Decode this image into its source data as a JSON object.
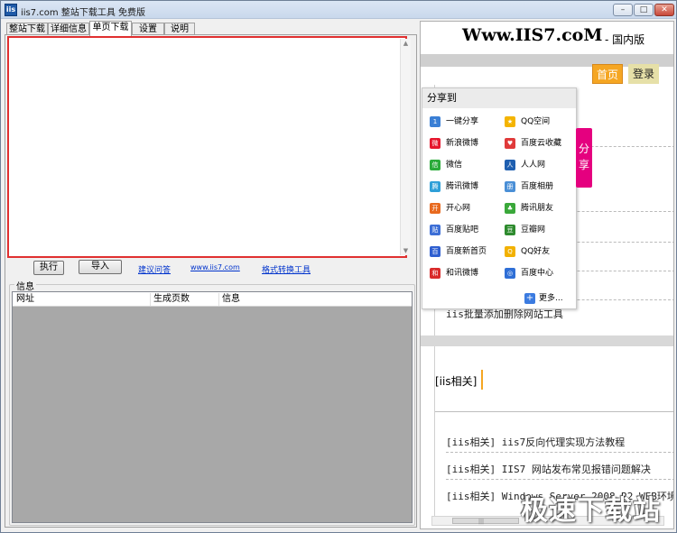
{
  "window": {
    "icon_text": "iis",
    "title": "iis7.com 整站下载工具 免费版",
    "min": "–",
    "max": "□",
    "close": "✕"
  },
  "tabs": [
    "整站下载",
    "详细信息",
    "单页下载",
    "设置",
    "说明"
  ],
  "active_tab": 2,
  "url_input": {
    "value": ""
  },
  "actions": {
    "execute": "执行",
    "import": "导入",
    "links": [
      "建议问答",
      "www.iis7.com",
      "格式转换工具"
    ]
  },
  "info": {
    "group_label": "信息",
    "columns": [
      "网址",
      "生成页数",
      "信息"
    ]
  },
  "browser": {
    "site_title": "Www.IIS7.coM",
    "site_subtitle": "- 国内版",
    "nav": {
      "home": "首页",
      "login": "登录"
    },
    "bg_lines": [
      "iis批量添加删除网站工具"
    ],
    "section_title": "[iis相关]",
    "articles": [
      "[iis相关] iis7反向代理实现方法教程",
      "[iis相关] IIS7 网站发布常见报错问题解决",
      "[iis相关] Windows Server 2008 R2 WEB环境"
    ],
    "scroll_grip": "|||"
  },
  "share": {
    "title": "分享到",
    "tab_label": "分享",
    "items": [
      {
        "label": "一键分享",
        "icon": "one-click-share-icon",
        "glyph": "1",
        "color": "#3a7fd5"
      },
      {
        "label": "QQ空间",
        "icon": "qzone-icon",
        "glyph": "★",
        "color": "#f4b400"
      },
      {
        "label": "新浪微博",
        "icon": "sina-weibo-icon",
        "glyph": "微",
        "color": "#e6162d"
      },
      {
        "label": "百度云收藏",
        "icon": "baidu-favorite-icon",
        "glyph": "♥",
        "color": "#e03a3a"
      },
      {
        "label": "微信",
        "icon": "wechat-icon",
        "glyph": "信",
        "color": "#2bab3a"
      },
      {
        "label": "人人网",
        "icon": "renren-icon",
        "glyph": "人",
        "color": "#1f5fb0"
      },
      {
        "label": "腾讯微博",
        "icon": "tencent-weibo-icon",
        "glyph": "腾",
        "color": "#2e9fd8"
      },
      {
        "label": "百度相册",
        "icon": "baidu-album-icon",
        "glyph": "册",
        "color": "#4a8fd6"
      },
      {
        "label": "开心网",
        "icon": "kaixin-icon",
        "glyph": "开",
        "color": "#e86a1f"
      },
      {
        "label": "腾讯朋友",
        "icon": "tencent-friends-icon",
        "glyph": "♣",
        "color": "#3aa83a"
      },
      {
        "label": "百度贴吧",
        "icon": "baidu-tieba-icon",
        "glyph": "贴",
        "color": "#3d6fd6"
      },
      {
        "label": "豆瓣网",
        "icon": "douban-icon",
        "glyph": "豆",
        "color": "#2e8b2e"
      },
      {
        "label": "百度新首页",
        "icon": "baidu-home-icon",
        "glyph": "百",
        "color": "#2f5fd0"
      },
      {
        "label": "QQ好友",
        "icon": "qq-friends-icon",
        "glyph": "Q",
        "color": "#f2b100"
      },
      {
        "label": "和讯微博",
        "icon": "hexun-weibo-icon",
        "glyph": "和",
        "color": "#d92b2b"
      },
      {
        "label": "百度中心",
        "icon": "baidu-center-icon",
        "glyph": "◎",
        "color": "#2f6fd6"
      }
    ],
    "more": "更多...",
    "more_glyph": "+"
  },
  "watermark": "极速下载站"
}
